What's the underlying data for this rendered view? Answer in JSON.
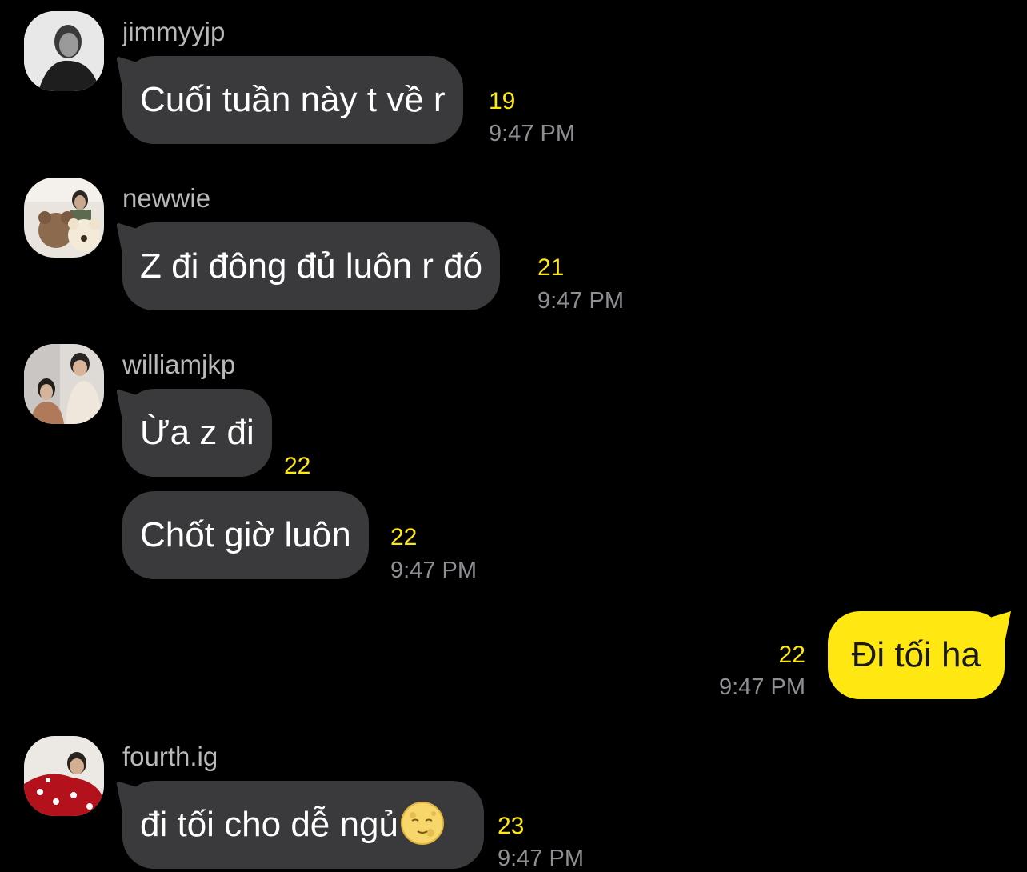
{
  "messages": [
    {
      "sender": "jimmyyjp",
      "text": "Cuối tuần này t về r",
      "count": "19",
      "time": "9:47 PM"
    },
    {
      "sender": "newwie",
      "text": "Z đi đông đủ luôn r đó",
      "count": "21",
      "time": "9:47 PM"
    },
    {
      "sender": "williamjkp",
      "text": "Ừa z đi",
      "count": "22",
      "text2": "Chốt giờ luôn",
      "count2": "22",
      "time": "9:47 PM"
    },
    {
      "sender": "me",
      "text": "Đi tối ha",
      "count": "22",
      "time": "9:47 PM"
    },
    {
      "sender": "fourth.ig",
      "text": "đi tối cho dễ ngủ",
      "emoji": "full-moon-face-emoji",
      "count": "23",
      "time": "9:47 PM"
    }
  ],
  "colors": {
    "background": "#000000",
    "bubble_other": "#3a3a3c",
    "bubble_mine": "#ffe812",
    "unread_count": "#ffe812",
    "timestamp": "#8e8e93",
    "username": "#b9b9b9"
  }
}
